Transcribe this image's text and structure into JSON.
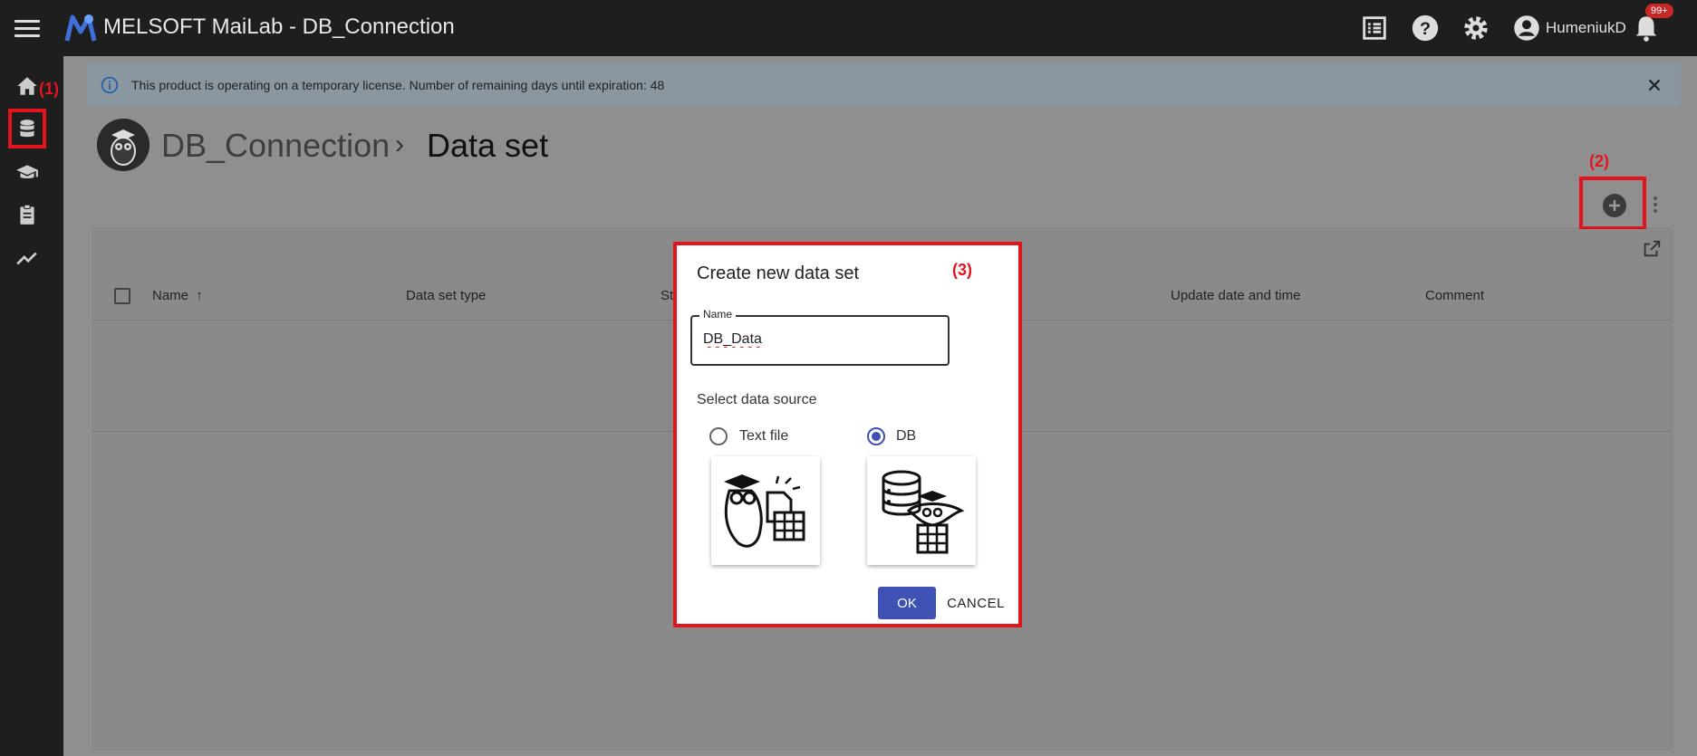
{
  "header": {
    "app_title": "MELSOFT MaiLab - DB_Connection",
    "user_name": "HumeniukD",
    "notification_badge": "99+",
    "icons": [
      "list-icon",
      "help-icon",
      "gear-icon",
      "account-icon",
      "bell-icon"
    ]
  },
  "sidebar": {
    "items": [
      "home-icon",
      "database-icon",
      "graduation-cap-icon",
      "clipboard-icon",
      "trending-icon"
    ]
  },
  "annotations": {
    "a1": "(1)",
    "a2": "(2)",
    "a3": "(3)",
    "color": "#e3141e"
  },
  "banner": {
    "text": "This product is operating on a temporary license. Number of remaining days until expiration: 48"
  },
  "breadcrumb": {
    "project": "DB_Connection",
    "separator": "›",
    "page": "Data set"
  },
  "table": {
    "columns": [
      "Name",
      "Data set type",
      "St",
      "Update date and time",
      "Comment"
    ]
  },
  "dialog": {
    "title": "Create new data set",
    "name_label": "Name",
    "name_value": "DB_Data",
    "source_label": "Select data source",
    "options": [
      {
        "label": "Text file",
        "selected": false
      },
      {
        "label": "DB",
        "selected": true
      }
    ],
    "ok_label": "OK",
    "cancel_label": "CANCEL",
    "accent": "#3f51b5"
  }
}
